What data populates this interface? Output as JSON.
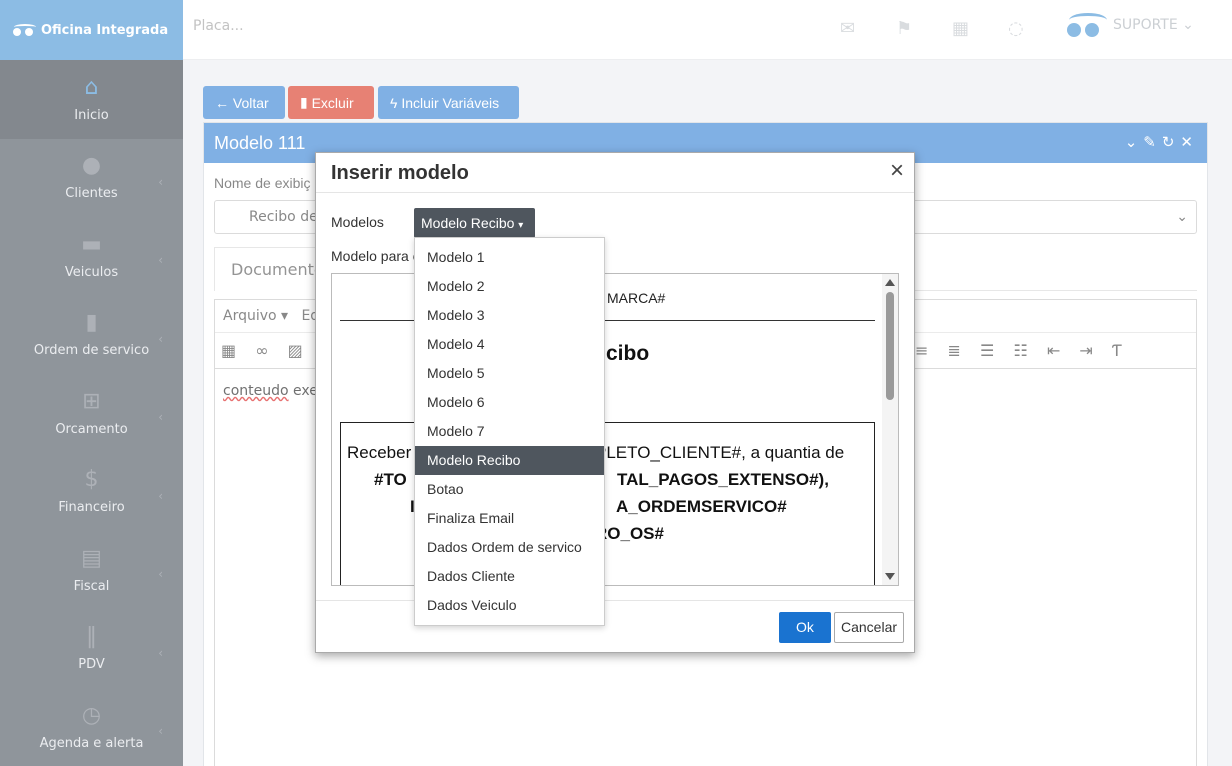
{
  "app": {
    "name": "Oficina Integrada",
    "search_placeholder": "Placa...",
    "user": "SUPORTE"
  },
  "sidebar": {
    "items": [
      {
        "label": "Inicio",
        "icon": "home-icon",
        "glyph": "⌂"
      },
      {
        "label": "Clientes",
        "icon": "users-icon",
        "glyph": "●"
      },
      {
        "label": "Veiculos",
        "icon": "car-icon",
        "glyph": "▬"
      },
      {
        "label": "Ordem de servico",
        "icon": "document-icon",
        "glyph": "▮"
      },
      {
        "label": "Orcamento",
        "icon": "calculator-icon",
        "glyph": "⊞"
      },
      {
        "label": "Financeiro",
        "icon": "dollar-icon",
        "glyph": "$"
      },
      {
        "label": "Fiscal",
        "icon": "spreadsheet-icon",
        "glyph": "▤"
      },
      {
        "label": "PDV",
        "icon": "barcode-icon",
        "glyph": "‖"
      },
      {
        "label": "Agenda e alerta",
        "icon": "clock-icon",
        "glyph": "◷"
      }
    ]
  },
  "toolbar": {
    "voltar": "Voltar",
    "excluir": "Excluir",
    "incluir": "Incluir Variáveis"
  },
  "panel": {
    "title": "Modelo 111",
    "nome_label": "Nome de exibiç",
    "select_value": "Recibo de",
    "tab_documento": "Documento",
    "menu_arquivo": "Arquivo",
    "menu_ed": "Ed",
    "content_word1": "conteudo",
    "content_word2": "exe"
  },
  "modal": {
    "title": "Inserir modelo",
    "close": "×",
    "models_label": "Modelos",
    "selected_model": "Modelo Recibo",
    "para_label": "Modelo para c",
    "ok": "Ok",
    "cancel": "Cancelar"
  },
  "preview": {
    "top_text": "MARCA#",
    "title": "cibo",
    "line1a": "Receber",
    "line1b": "PLETO_CLIENTE#, a quantia de",
    "line2a": "#TO",
    "line2b": "TAL_PAGOS_EXTENSO#),",
    "line3a": "I",
    "line3b": "A_ORDEMSERVICO#",
    "line4b": "RO_OS#"
  },
  "dropdown": {
    "items": [
      {
        "label": "Modelo 1",
        "selected": false
      },
      {
        "label": "Modelo 2",
        "selected": false
      },
      {
        "label": "Modelo 3",
        "selected": false
      },
      {
        "label": "Modelo 4",
        "selected": false
      },
      {
        "label": "Modelo 5",
        "selected": false
      },
      {
        "label": "Modelo 6",
        "selected": false
      },
      {
        "label": "Modelo 7",
        "selected": false
      },
      {
        "label": "Modelo Recibo",
        "selected": true
      },
      {
        "label": "Botao",
        "selected": false
      },
      {
        "label": "Finaliza Email",
        "selected": false
      },
      {
        "label": "Dados Ordem de servico",
        "selected": false
      },
      {
        "label": "Dados Cliente",
        "selected": false
      },
      {
        "label": "Dados Veiculo",
        "selected": false
      }
    ]
  },
  "colors": {
    "brand": "#5ba0d8",
    "primary": "#4a8fd8",
    "danger": "#dd4b39",
    "ok": "#1a73d0",
    "sidebar": "#5f6770",
    "selected": "#4f565e"
  }
}
